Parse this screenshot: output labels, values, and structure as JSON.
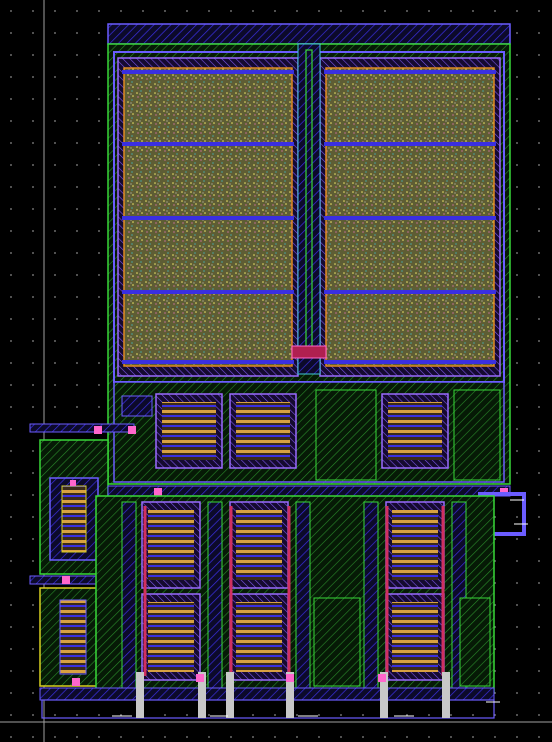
{
  "view": {
    "kind": "ic-layout-editor-canvas",
    "grid": "dotted",
    "layers": {
      "background": "#000000",
      "grid_dot": "#8a8a8a",
      "nwell": "#1f8f1f",
      "active": "#2aa84a",
      "active_outline": "#38d838",
      "poly": "#d03060",
      "metal1": "#3a2fe0",
      "metal1_outline": "#6b5cff",
      "metal2": "#9a6bff",
      "implant_yellow": "#d8d020",
      "capacitor_fill": "#6b6a3a",
      "capacitor_speckle": "#e8e060",
      "contact": "#ff66cc",
      "via": "#c8c8c8",
      "label_white": "#ffffff",
      "orange_edge": "#e08a20",
      "cyan_edge": "#40c8d8"
    }
  }
}
